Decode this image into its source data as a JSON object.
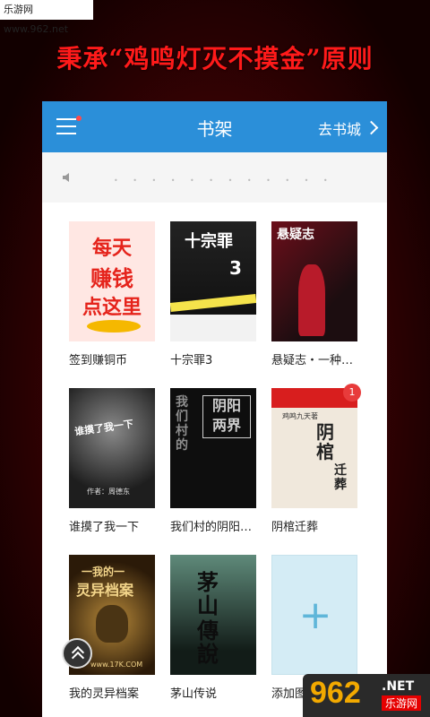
{
  "watermark_top": "乐游网 www.962.net",
  "headline": "秉承“鸡鸣灯灭不摸金”原则",
  "appbar": {
    "title": "书架",
    "store_label": "去书城"
  },
  "books": [
    {
      "title": "签到赚铜币",
      "cover_text": [
        "每天",
        "赚钱",
        "点这里"
      ],
      "colors": [
        "#ffe7e3",
        "#e5231b"
      ]
    },
    {
      "title": "十宗罪3",
      "cover_text": [
        "十宗罪",
        "3"
      ],
      "colors": [
        "#f5e34b",
        "#1a1a1a"
      ]
    },
    {
      "title": "悬疑志・一种…",
      "cover_text": [
        "悬疑志"
      ],
      "colors": [
        "#b81b2a",
        "#1c0d10"
      ]
    },
    {
      "title": "谁摸了我一下",
      "cover_text": [
        "谁摸了我一下",
        "作者：周德东"
      ],
      "colors": [
        "#8a8a8a",
        "#1e1e1e"
      ]
    },
    {
      "title": "我们村的阴阳…",
      "cover_text": [
        "阴阳",
        "两界",
        "我们村的"
      ],
      "colors": [
        "#cfcfcf",
        "#0e0e0e"
      ]
    },
    {
      "title": "阴棺迁葬",
      "cover_text": [
        "阴棺",
        "迁葬",
        "鸡鸣九天著"
      ],
      "colors": [
        "#d81e1e",
        "#f0e8dc"
      ],
      "badge": "1"
    },
    {
      "title": "我的灵异档案",
      "cover_text": [
        "一我的一",
        "灵异档案",
        "www.17K.COM"
      ],
      "colors": [
        "#b88a3a",
        "#2b1a08"
      ]
    },
    {
      "title": "茅山传说",
      "cover_text": [
        "茅山",
        "傳說"
      ],
      "colors": [
        "#5f8a7a",
        "#121c18"
      ]
    },
    {
      "title": "添加图书",
      "is_add": true
    }
  ],
  "watermark_bottom": {
    "big": "962",
    "net": ".NET",
    "sub": "乐游网"
  }
}
